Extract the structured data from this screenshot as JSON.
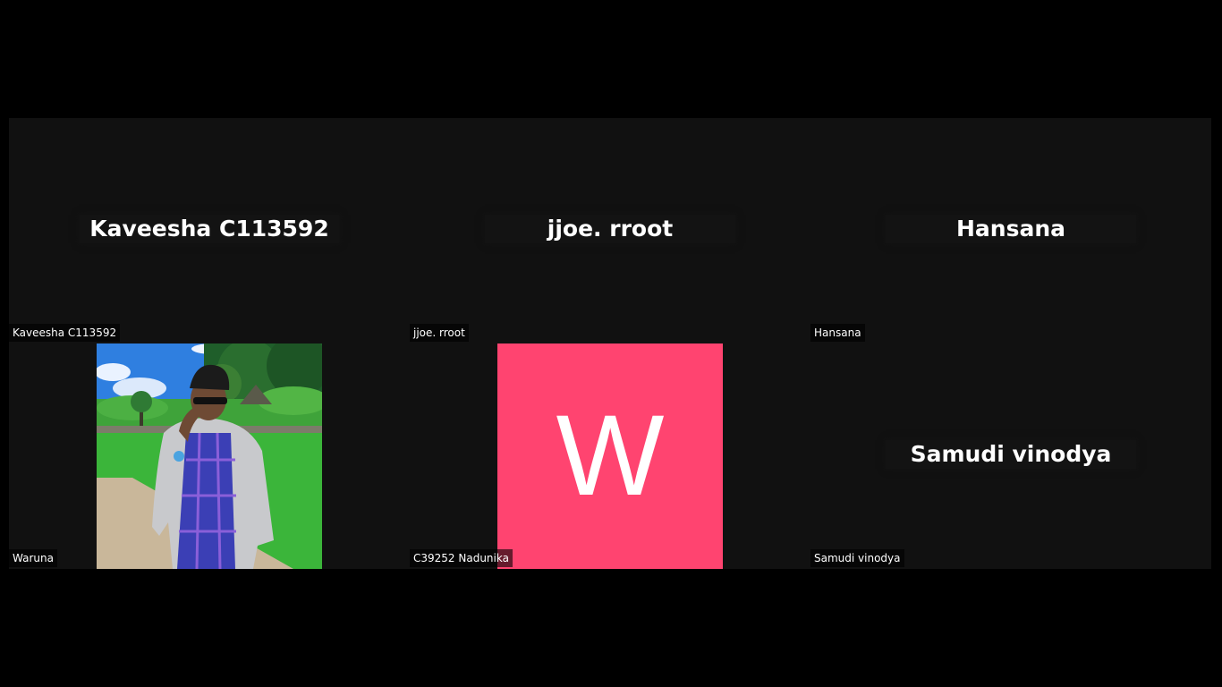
{
  "participants": [
    {
      "id": "p1",
      "display_name": "Kaveesha C113592",
      "label": "Kaveesha C113592"
    },
    {
      "id": "p2",
      "display_name": "jjoe. rroot",
      "label": "jjoe. rroot"
    },
    {
      "id": "p3",
      "display_name": "Hansana",
      "label": "Hansana"
    },
    {
      "id": "p4",
      "label": "Waruna",
      "avatar": "photo"
    },
    {
      "id": "p5",
      "label": "C39252 Nadunika",
      "avatar_letter": "W",
      "avatar_color": "#ff4470"
    },
    {
      "id": "p6",
      "display_name": "Samudi vinodya",
      "label": "Samudi vinodya"
    }
  ],
  "colors": {
    "tile_bg": "#111111",
    "window_bg": "#000000",
    "avatar_pink": "#ff4470"
  }
}
